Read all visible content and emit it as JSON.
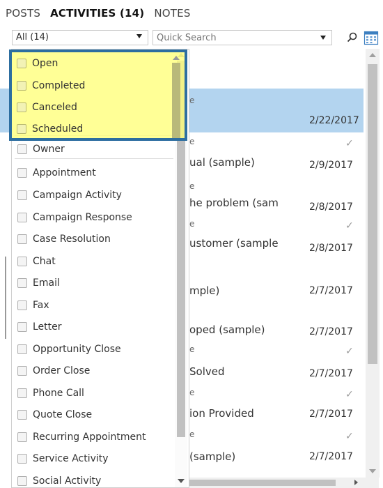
{
  "tabs": [
    {
      "label": "POSTS"
    },
    {
      "label": "ACTIVITIES (14)"
    },
    {
      "label": "NOTES"
    }
  ],
  "filter": {
    "selected": "All (14)"
  },
  "search": {
    "placeholder": "Quick Search"
  },
  "icons": {
    "search": "search-icon",
    "calendar": "calendar-icon"
  },
  "colors": {
    "highlight_fill": "#ffff78",
    "highlight_border": "#2d6ea0",
    "selected_row": "#b3d4ef"
  },
  "dropdown": {
    "highlighted_items": [
      {
        "label": "Open"
      },
      {
        "label": "Completed"
      },
      {
        "label": "Canceled"
      },
      {
        "label": "Scheduled"
      }
    ],
    "items": [
      {
        "label": "Owner"
      },
      {
        "label": "Appointment"
      },
      {
        "label": "Campaign Activity"
      },
      {
        "label": "Campaign Response"
      },
      {
        "label": "Case Resolution"
      },
      {
        "label": "Chat"
      },
      {
        "label": "Email"
      },
      {
        "label": "Fax"
      },
      {
        "label": "Letter"
      },
      {
        "label": "Opportunity Close"
      },
      {
        "label": "Order Close"
      },
      {
        "label": "Phone Call"
      },
      {
        "label": "Quote Close"
      },
      {
        "label": "Recurring Appointment"
      },
      {
        "label": "Service Activity"
      },
      {
        "label": "Social Activity"
      }
    ]
  },
  "activities": [
    {
      "title": "",
      "date": "2/22/2017",
      "check": ""
    },
    {
      "title": "ual (sample)",
      "date": "2/9/2017",
      "check": "✓"
    },
    {
      "title": "he problem (sam",
      "date": "2/8/2017",
      "check": ""
    },
    {
      "title": "ustomer (sample",
      "date": "2/8/2017",
      "check": "✓"
    },
    {
      "title": "mple)",
      "date": "2/7/2017",
      "check": ""
    },
    {
      "title": "oped (sample)",
      "date": "2/7/2017",
      "check": ""
    },
    {
      "title": "Solved",
      "date": "2/7/2017",
      "check": "✓"
    },
    {
      "title": "ion Provided",
      "date": "2/7/2017",
      "check": "✓"
    },
    {
      "title": "(sample)",
      "date": "2/7/2017",
      "check": "✓"
    }
  ]
}
